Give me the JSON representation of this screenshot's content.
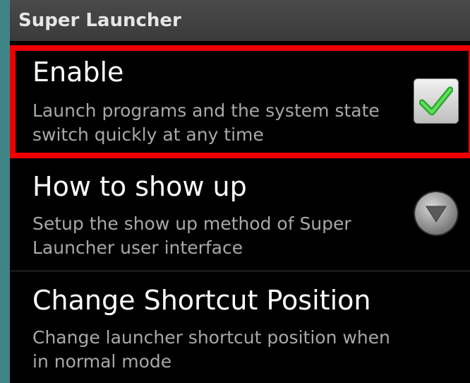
{
  "header": {
    "title": "Super Launcher"
  },
  "settings": {
    "items": [
      {
        "title": "Enable",
        "description": "Launch programs and the system state switch quickly at any time",
        "control": "checkbox",
        "checked": true
      },
      {
        "title": "How to show up",
        "description": "Setup the show up method of Super Launcher user interface",
        "control": "dropdown"
      },
      {
        "title": "Change Shortcut Position",
        "description": "Change launcher shortcut position when in normal mode"
      }
    ]
  },
  "icons": {
    "checkbox": "check-icon",
    "dropdown": "chevron-down-icon"
  },
  "colors": {
    "highlight": "#ee0000",
    "check": "#3cc23c",
    "background": "#000000",
    "header": "#444444"
  }
}
